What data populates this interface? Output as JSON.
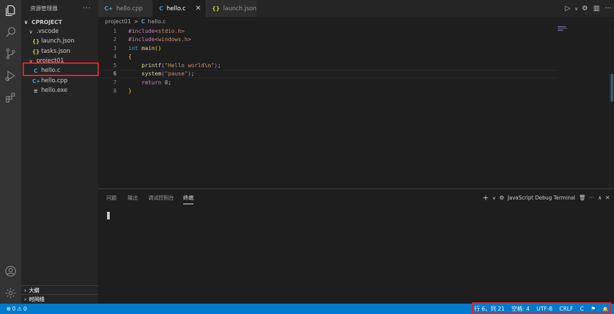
{
  "sidebar": {
    "title": "资源管理器",
    "more": "···",
    "tree": [
      {
        "label": "CPROJECT",
        "chev": "∨",
        "icon": "",
        "icon_name": "",
        "type": "root"
      },
      {
        "label": ".vscode",
        "chev": "∨",
        "icon": "",
        "icon_name": "",
        "type": "folder"
      },
      {
        "label": "launch.json",
        "chev": "",
        "icon": "{}",
        "icon_name": "json-file-icon",
        "type": "json"
      },
      {
        "label": "tasks.json",
        "chev": "",
        "icon": "{}",
        "icon_name": "json-file-icon",
        "type": "json"
      },
      {
        "label": "project01",
        "chev": "∨",
        "icon": "",
        "icon_name": "",
        "type": "folder"
      },
      {
        "label": "hello.c",
        "chev": "",
        "icon": "C",
        "icon_name": "c-file-icon",
        "type": "c"
      },
      {
        "label": "hello.cpp",
        "chev": "",
        "icon": "C+",
        "icon_name": "cpp-file-icon",
        "type": "cpp"
      },
      {
        "label": "hello.exe",
        "chev": "",
        "icon": "≡",
        "icon_name": "exe-file-icon",
        "type": "exe"
      }
    ],
    "outline": "大纲",
    "timeline": "时间线"
  },
  "tabs": [
    {
      "label": "hello.cpp",
      "icon": "C+",
      "icon_name": "cpp-file-icon",
      "active": false
    },
    {
      "label": "hello.c",
      "icon": "C",
      "icon_name": "c-file-icon",
      "active": true,
      "close": "✕"
    },
    {
      "label": "launch.json",
      "icon": "{}",
      "icon_name": "json-file-icon",
      "active": false
    }
  ],
  "breadcrumb": {
    "folder": "project01",
    "sep": ">",
    "icon": "C",
    "file": "hello.c"
  },
  "code": {
    "lines": [
      {
        "n": "1",
        "tokens": [
          {
            "t": "#include",
            "c": "#c586c0"
          },
          {
            "t": "<stdio.h>",
            "c": "#ce9178"
          }
        ]
      },
      {
        "n": "2",
        "tokens": [
          {
            "t": "#include",
            "c": "#c586c0"
          },
          {
            "t": "<windows.h>",
            "c": "#ce9178"
          }
        ]
      },
      {
        "n": "3",
        "tokens": [
          {
            "t": "int",
            "c": "#569cd6"
          },
          {
            "t": " ",
            "c": "#d4d4d4"
          },
          {
            "t": "main",
            "c": "#dcdcaa"
          },
          {
            "t": "()",
            "c": "#ffd700"
          }
        ]
      },
      {
        "n": "4",
        "tokens": [
          {
            "t": "{",
            "c": "#ffd700"
          }
        ]
      },
      {
        "n": "5",
        "tokens": [
          {
            "t": "    ",
            "c": "#d4d4d4"
          },
          {
            "t": "printf",
            "c": "#dcdcaa"
          },
          {
            "t": "(",
            "c": "#da70d6"
          },
          {
            "t": "\"Hello world",
            "c": "#ce9178"
          },
          {
            "t": "\\n",
            "c": "#d7ba7d"
          },
          {
            "t": "\"",
            "c": "#ce9178"
          },
          {
            "t": ")",
            "c": "#da70d6"
          },
          {
            "t": ";",
            "c": "#d4d4d4"
          }
        ]
      },
      {
        "n": "6",
        "tokens": [
          {
            "t": "    ",
            "c": "#d4d4d4"
          },
          {
            "t": "system",
            "c": "#dcdcaa"
          },
          {
            "t": "(",
            "c": "#da70d6"
          },
          {
            "t": "\"pause\"",
            "c": "#ce9178"
          },
          {
            "t": ")",
            "c": "#da70d6"
          },
          {
            "t": ";",
            "c": "#d4d4d4"
          }
        ]
      },
      {
        "n": "7",
        "tokens": [
          {
            "t": "    ",
            "c": "#d4d4d4"
          },
          {
            "t": "return",
            "c": "#c586c0"
          },
          {
            "t": " ",
            "c": "#d4d4d4"
          },
          {
            "t": "0",
            "c": "#b5cea8"
          },
          {
            "t": ";",
            "c": "#d4d4d4"
          }
        ]
      },
      {
        "n": "8",
        "tokens": [
          {
            "t": "}",
            "c": "#ffd700"
          }
        ]
      }
    ],
    "current_line": "6"
  },
  "panel": {
    "tabs": [
      "问题",
      "输出",
      "调试控制台",
      "终端"
    ],
    "active_tab": "终端",
    "add": "+",
    "dropdown": "∨",
    "terminal_icon": "⚙",
    "terminal_name": "JavaScript Debug Terminal",
    "trash": "🗑",
    "more": "···",
    "maximize": "∧",
    "close": "✕"
  },
  "statusbar": {
    "errors": "0",
    "warnings": "0",
    "position": "行 6，列 21",
    "spaces": "空格: 4",
    "encoding": "UTF-8",
    "eol": "CRLF",
    "language": "C",
    "feedback_icon": "⚑",
    "bell_icon": "🔔"
  },
  "colors": {
    "accent": "#007acc",
    "highlight_box": "#e0242c"
  }
}
